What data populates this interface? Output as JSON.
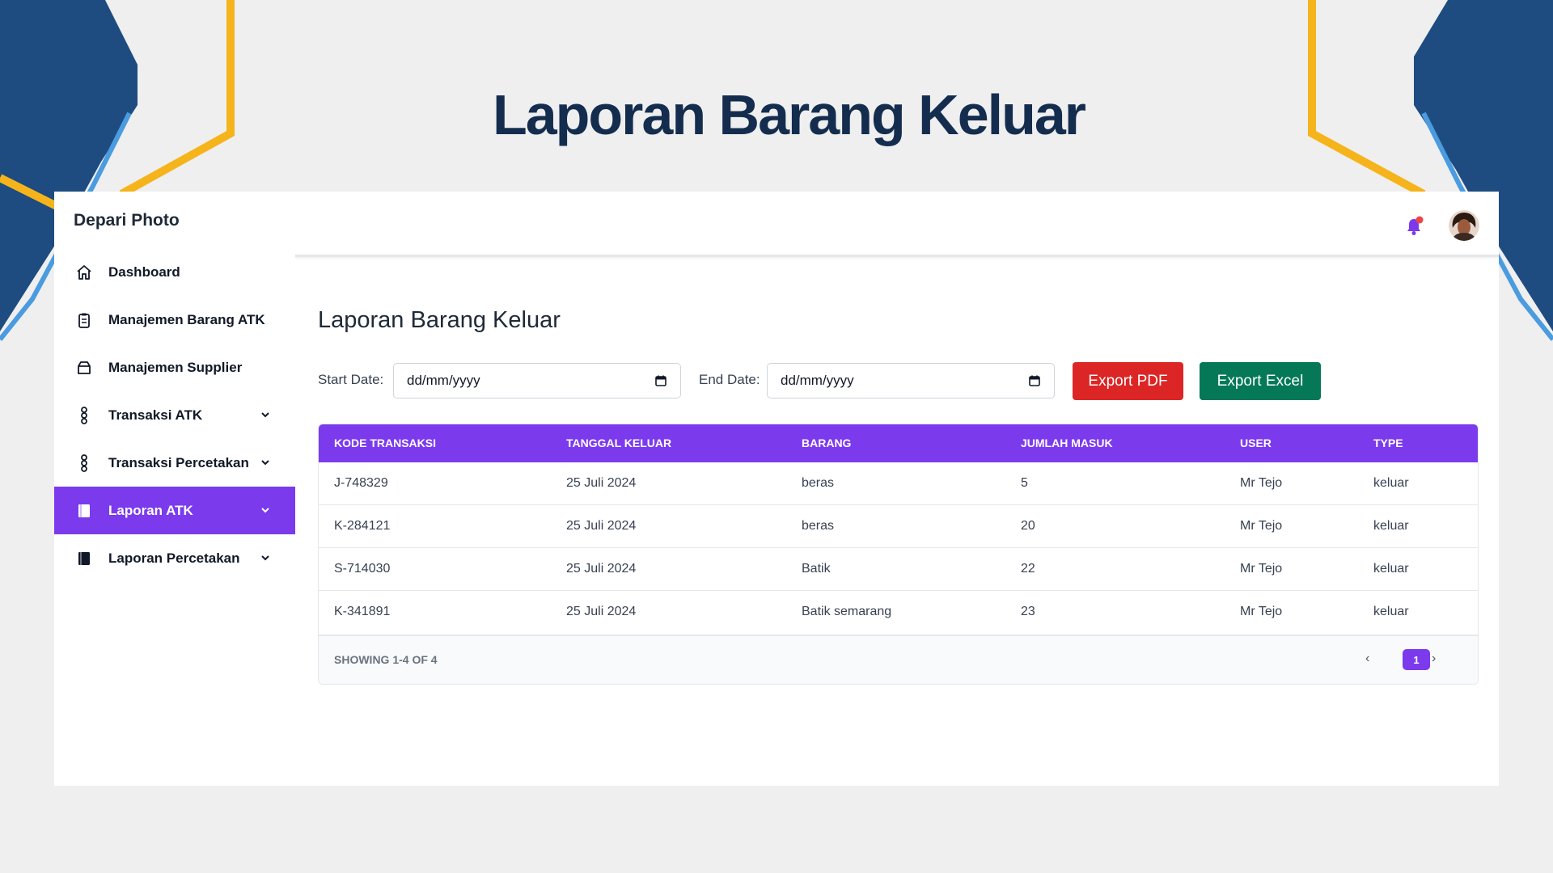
{
  "slide": {
    "title": "Laporan Barang Keluar"
  },
  "app": {
    "brand": "Depari Photo"
  },
  "sidebar": {
    "items": [
      {
        "label": "Dashboard",
        "icon": "home-icon"
      },
      {
        "label": "Manajemen Barang ATK",
        "icon": "clipboard-icon"
      },
      {
        "label": "Manajemen Supplier",
        "icon": "box-icon"
      },
      {
        "label": "Transaksi ATK",
        "icon": "transaction-icon"
      },
      {
        "label": "Transaksi Percetakan",
        "icon": "transaction-icon"
      },
      {
        "label": "Laporan ATK",
        "icon": "report-icon"
      },
      {
        "label": "Laporan Percetakan",
        "icon": "report-icon"
      }
    ]
  },
  "page": {
    "heading": "Laporan Barang Keluar"
  },
  "filters": {
    "start_label": "Start Date:",
    "start_value": "dd/mm/yyyy",
    "end_label": "End Date:",
    "end_value": "dd/mm/yyyy"
  },
  "buttons": {
    "export_pdf": "Export PDF",
    "export_excel": "Export Excel"
  },
  "table": {
    "headers": [
      "KODE TRANSAKSI",
      "TANGGAL KELUAR",
      "BARANG",
      "JUMLAH MASUK",
      "USER",
      "TYPE"
    ],
    "rows": [
      [
        "J-748329",
        "25 Juli 2024",
        "beras",
        "5",
        "Mr Tejo",
        "keluar"
      ],
      [
        "K-284121",
        "25 Juli 2024",
        "beras",
        "20",
        "Mr Tejo",
        "keluar"
      ],
      [
        "S-714030",
        "25 Juli 2024",
        "Batik",
        "22",
        "Mr Tejo",
        "keluar"
      ],
      [
        "K-341891",
        "25 Juli 2024",
        "Batik semarang",
        "23",
        "Mr Tejo",
        "keluar"
      ]
    ],
    "footer": {
      "showing": "SHOWING 1-4 OF 4",
      "prev": "‹",
      "current_page": "1",
      "next": "›"
    }
  },
  "colors": {
    "accent": "#7c3aed",
    "pdf": "#dc2626",
    "excel": "#047857",
    "title": "#142d4f",
    "notification_dot": "#ef4444"
  }
}
